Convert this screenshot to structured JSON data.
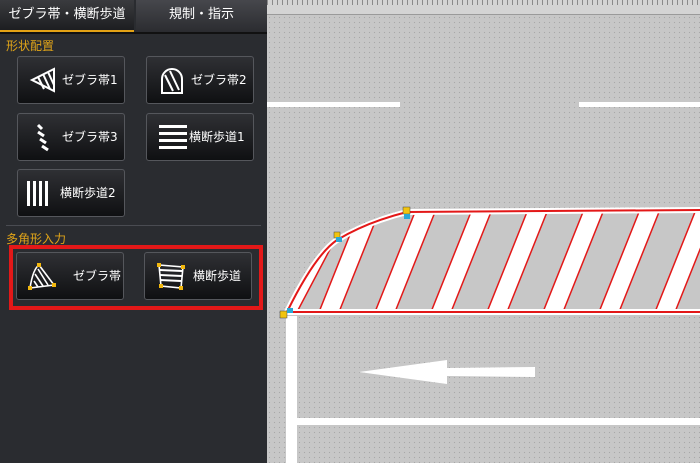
{
  "tabs": [
    {
      "label": "ゼブラ帯・横断歩道"
    },
    {
      "label": "規制・指示"
    }
  ],
  "sections": {
    "shape_placement": "形状配置",
    "polygon_input": "多角形入力"
  },
  "shape_buttons": [
    {
      "label": "ゼブラ帯1",
      "icon": "zebra-triangle-icon"
    },
    {
      "label": "ゼブラ帯2",
      "icon": "zebra-arch-icon"
    },
    {
      "label": "ゼブラ帯3",
      "icon": "zebra-diagonal-icon"
    },
    {
      "label": "横断歩道1",
      "icon": "crosswalk-horizontal-icon"
    },
    {
      "label": "横断歩道2",
      "icon": "crosswalk-vertical-icon"
    }
  ],
  "polygon_buttons": [
    {
      "label": "ゼブラ帯",
      "icon": "polygon-zebra-icon"
    },
    {
      "label": "横断歩道",
      "icon": "polygon-crosswalk-icon"
    }
  ],
  "colors": {
    "accent": "#e0a419",
    "highlight": "#e31818",
    "panel_bg": "#2a2c30",
    "canvas_bg": "#c7c7c7",
    "selection": "#e31818"
  }
}
